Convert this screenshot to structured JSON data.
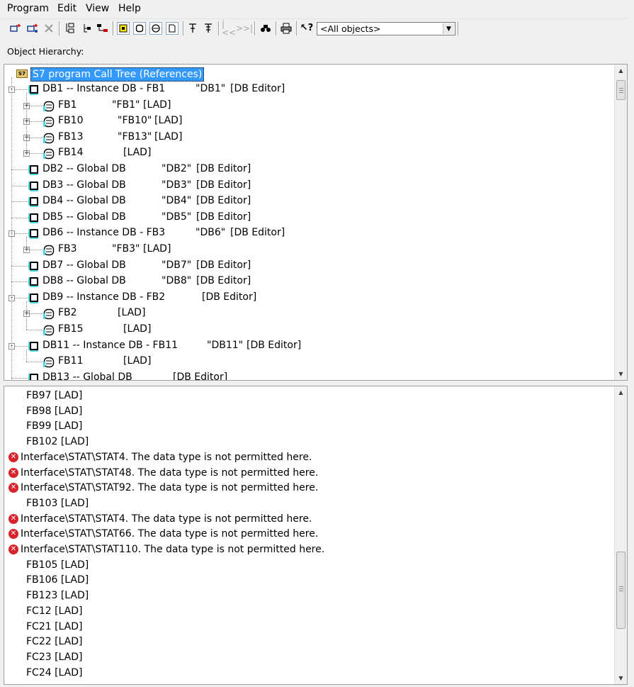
{
  "menu": [
    "Program",
    "Edit",
    "View",
    "Help"
  ],
  "toolbar": {
    "filter_value": "<All objects>",
    "icons": [
      "open-icon",
      "open-online-icon",
      "delete-icon",
      "display-icon",
      "tree-icon",
      "references-icon",
      "db-filter-icon",
      "fb-filter-icon",
      "fc-filter-icon",
      "udt-filter-icon",
      "unused-icon",
      "collapse-icon",
      "prev-icon",
      "next-icon",
      "find-icon",
      "print-icon",
      "help-icon"
    ]
  },
  "header_label": "Object Hierarchy:",
  "tree": {
    "root": "S7 program Call Tree (References)",
    "nodes": [
      {
        "level": 1,
        "icon": "db",
        "name": "DB1 -- Instance DB - FB1",
        "sym": "\"DB1\"",
        "ed": "[DB Editor]",
        "exp": "-"
      },
      {
        "level": 2,
        "icon": "fb",
        "name": "FB1",
        "sym": "\"FB1\"",
        "ed": "[LAD]",
        "exp": "+"
      },
      {
        "level": 2,
        "icon": "fb",
        "name": "FB10",
        "sym": "\"FB10\"",
        "ed": "[LAD]",
        "exp": "+"
      },
      {
        "level": 2,
        "icon": "fb",
        "name": "FB13",
        "sym": "\"FB13\"",
        "ed": "[LAD]",
        "exp": "+"
      },
      {
        "level": 2,
        "icon": "fb",
        "name": "FB14",
        "sym": "",
        "ed": "[LAD]",
        "exp": "+"
      },
      {
        "level": 1,
        "icon": "db",
        "name": "DB2 -- Global DB",
        "sym": "\"DB2\"",
        "ed": "[DB Editor]",
        "exp": ""
      },
      {
        "level": 1,
        "icon": "db",
        "name": "DB3 -- Global DB",
        "sym": "\"DB3\"",
        "ed": "[DB Editor]",
        "exp": ""
      },
      {
        "level": 1,
        "icon": "db",
        "name": "DB4 -- Global DB",
        "sym": "\"DB4\"",
        "ed": "[DB Editor]",
        "exp": ""
      },
      {
        "level": 1,
        "icon": "db",
        "name": "DB5 -- Global DB",
        "sym": "\"DB5\"",
        "ed": "[DB Editor]",
        "exp": ""
      },
      {
        "level": 1,
        "icon": "db",
        "name": "DB6 -- Instance DB - FB3",
        "sym": "\"DB6\"",
        "ed": "[DB Editor]",
        "exp": "-"
      },
      {
        "level": 2,
        "icon": "fb",
        "name": "FB3",
        "sym": "\"FB3\"",
        "ed": "[LAD]",
        "exp": "+"
      },
      {
        "level": 1,
        "icon": "db",
        "name": "DB7 -- Global DB",
        "sym": "\"DB7\"",
        "ed": "[DB Editor]",
        "exp": ""
      },
      {
        "level": 1,
        "icon": "db",
        "name": "DB8 -- Global DB",
        "sym": "\"DB8\"",
        "ed": "[DB Editor]",
        "exp": ""
      },
      {
        "level": 1,
        "icon": "db",
        "name": "DB9 -- Instance DB - FB2",
        "sym": "",
        "ed": "[DB Editor]",
        "exp": "-"
      },
      {
        "level": 2,
        "icon": "fb",
        "name": "FB2",
        "sym": "",
        "ed": "[LAD]",
        "exp": "+"
      },
      {
        "level": 2,
        "icon": "fb",
        "name": "FB15",
        "sym": "",
        "ed": "[LAD]",
        "exp": ""
      },
      {
        "level": 1,
        "icon": "db",
        "name": "DB11 -- Instance DB - FB11",
        "sym": "\"DB11\"",
        "ed": "[DB Editor]",
        "exp": "-"
      },
      {
        "level": 2,
        "icon": "fb",
        "name": "FB11",
        "sym": "",
        "ed": "[LAD]",
        "exp": ""
      },
      {
        "level": 1,
        "icon": "db",
        "name": "DB13 -- Global DB",
        "sym": "",
        "ed": "[DB Editor]",
        "exp": ""
      }
    ]
  },
  "messages": [
    {
      "type": "item",
      "text": "FB97  [LAD]"
    },
    {
      "type": "item",
      "text": "FB98  [LAD]"
    },
    {
      "type": "item",
      "text": "FB99  [LAD]"
    },
    {
      "type": "item",
      "text": "FB102  [LAD]"
    },
    {
      "type": "error",
      "text": "Interface\\STAT\\STAT4. The data type is not permitted here."
    },
    {
      "type": "error",
      "text": "Interface\\STAT\\STAT48. The data type is not permitted here."
    },
    {
      "type": "error",
      "text": "Interface\\STAT\\STAT92. The data type is not permitted here."
    },
    {
      "type": "item",
      "text": "FB103  [LAD]"
    },
    {
      "type": "error",
      "text": "Interface\\STAT\\STAT4. The data type is not permitted here."
    },
    {
      "type": "error",
      "text": "Interface\\STAT\\STAT66. The data type is not permitted here."
    },
    {
      "type": "error",
      "text": "Interface\\STAT\\STAT110. The data type is not permitted here."
    },
    {
      "type": "item",
      "text": "FB105  [LAD]"
    },
    {
      "type": "item",
      "text": "FB106  [LAD]"
    },
    {
      "type": "item",
      "text": "FB123  [LAD]"
    },
    {
      "type": "item",
      "text": "FC12  [LAD]"
    },
    {
      "type": "item",
      "text": "FC21  [LAD]"
    },
    {
      "type": "item",
      "text": "FC22  [LAD]"
    },
    {
      "type": "item",
      "text": "FC23  [LAD]"
    },
    {
      "type": "item",
      "text": "FC24  [LAD]"
    }
  ]
}
